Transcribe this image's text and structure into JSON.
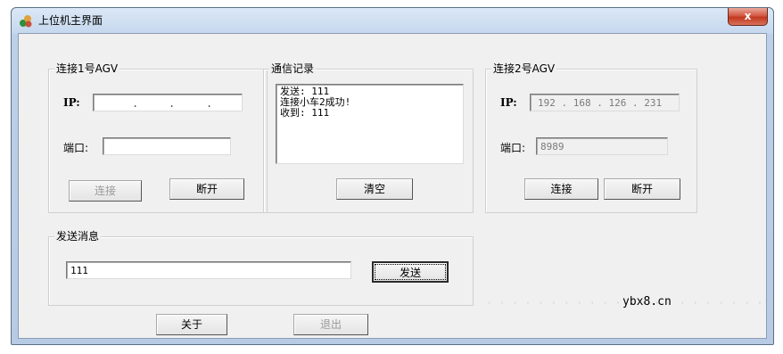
{
  "window": {
    "title": "上位机主界面",
    "close_label": "x"
  },
  "agv1": {
    "group_title": "连接1号AGV",
    "ip_label": "IP:",
    "ip_dots": [
      ".",
      ".",
      "."
    ],
    "port_label": "端口:",
    "port_value": "",
    "connect_label": "连接",
    "connect_enabled": false,
    "disconnect_label": "断开"
  },
  "comm": {
    "group_title": "通信记录",
    "lines": [
      "发送: 111",
      "连接小车2成功!",
      "收到: 111"
    ],
    "clear_label": "清空"
  },
  "agv2": {
    "group_title": "连接2号AGV",
    "ip_label": "IP:",
    "ip_value": "192 . 168 . 126 . 231",
    "port_label": "端口:",
    "port_value": "8989",
    "connect_label": "连接",
    "disconnect_label": "断开"
  },
  "send": {
    "group_title": "发送消息",
    "message_value": "111",
    "send_label": "发送"
  },
  "footer": {
    "about_label": "关于",
    "exit_label": "退出",
    "exit_enabled": false
  },
  "watermark": {
    "text": "ybx8.cn"
  }
}
